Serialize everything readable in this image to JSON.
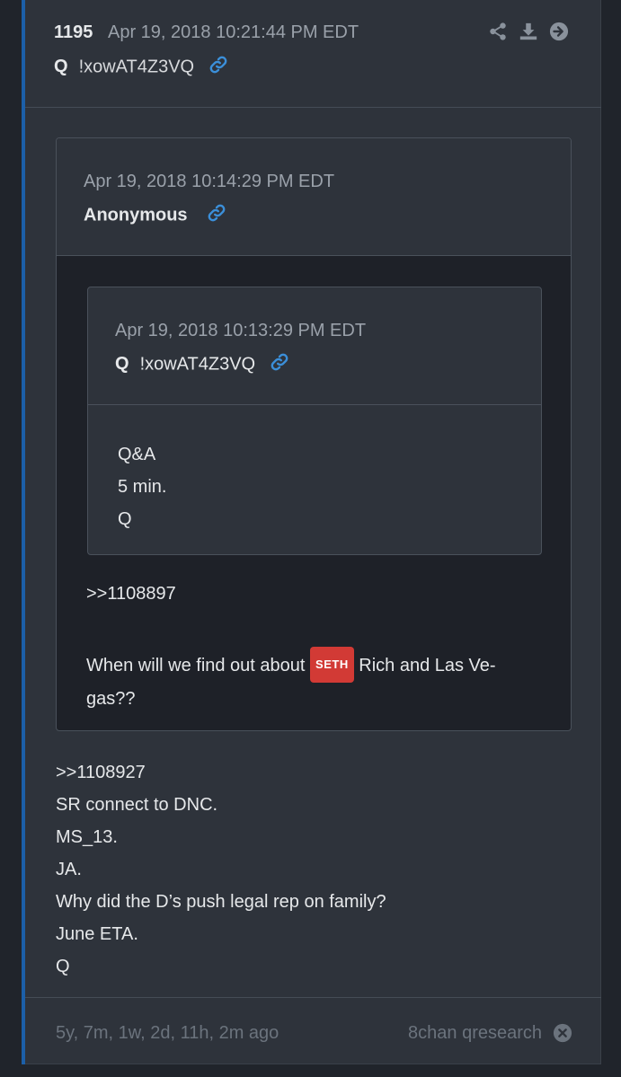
{
  "post": {
    "number": "1195",
    "date": "Apr 19, 2018 10:21:44 PM EDT",
    "author_name": "Q",
    "tripcode": "!xowAT4Z3VQ",
    "body_lines": [
      ">>1108927",
      "SR connect to DNC.",
      "MS_13.",
      "JA.",
      "Why did the D’s push legal rep on family?",
      "June ETA.",
      "Q"
    ]
  },
  "quote_anon": {
    "date": "Apr 19, 2018 10:14:29 PM EDT",
    "author_name": "Anonymous",
    "reference": ">>1108897",
    "text_before": "When will we find out about ",
    "tag": "SETH",
    "text_after": " Rich and Las Ve-gas??"
  },
  "quote_q": {
    "date": "Apr 19, 2018 10:13:29 PM EDT",
    "author_name": "Q",
    "tripcode": "!xowAT4Z3VQ",
    "body_lines": [
      "Q&A",
      "5 min.",
      "Q"
    ]
  },
  "footer": {
    "ago": "5y, 7m, 1w, 2d, 11h, 2m ago",
    "source": "8chan qresearch"
  },
  "colors": {
    "accent": "#1c5fa8",
    "link_icon": "#3b8fd9",
    "tag_bg": "#d23a35"
  },
  "icons": [
    "share-icon",
    "download-icon",
    "arrow-right-circle-icon",
    "link-icon",
    "close-circle-icon"
  ]
}
